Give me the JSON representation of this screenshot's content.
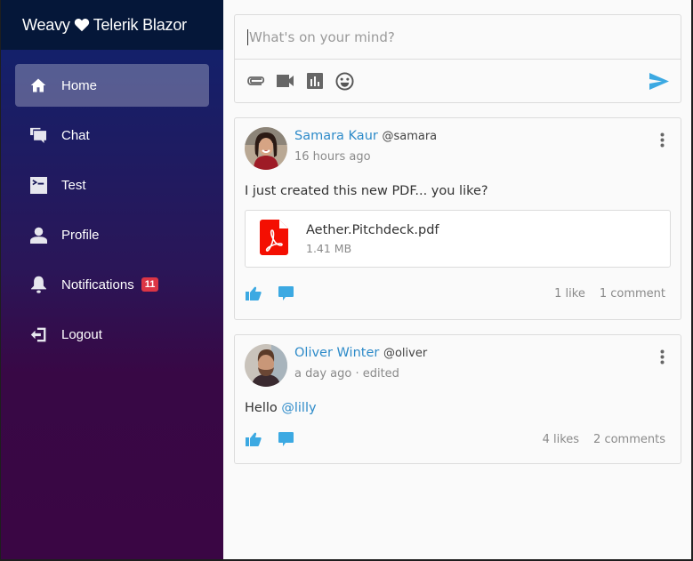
{
  "sidebar": {
    "brand": {
      "left": "Weavy",
      "icon": "heart-icon",
      "right": "Telerik Blazor"
    },
    "items": [
      {
        "label": "Home",
        "icon": "home-icon",
        "active": true
      },
      {
        "label": "Chat",
        "icon": "chat-icon",
        "active": false
      },
      {
        "label": "Test",
        "icon": "terminal-icon",
        "active": false
      },
      {
        "label": "Profile",
        "icon": "user-icon",
        "active": false
      },
      {
        "label": "Notifications",
        "icon": "bell-icon",
        "active": false,
        "badge": "11"
      },
      {
        "label": "Logout",
        "icon": "logout-icon",
        "active": false
      }
    ]
  },
  "composer": {
    "placeholder": "What's on your mind?",
    "tools": [
      "attach-icon",
      "video-icon",
      "poll-icon",
      "emoji-icon"
    ],
    "send_icon": "send-icon"
  },
  "colors": {
    "accent": "#2e8bc9",
    "send": "#3ca9e2",
    "badge": "#dc3545",
    "pdf": "#f40f02"
  },
  "posts": [
    {
      "author": "Samara Kaur",
      "handle": "@samara",
      "time": "16 hours ago",
      "text": "I just created this new PDF... you like?",
      "attachment": {
        "name": "Aether.Pitchdeck.pdf",
        "size": "1.41 MB",
        "icon": "pdf-icon"
      },
      "likes": "1 like",
      "comments": "1 comment"
    },
    {
      "author": "Oliver Winter",
      "handle": "@oliver",
      "time": "a day ago · edited",
      "text": "Hello ",
      "mention": "@lilly",
      "likes": "4 likes",
      "comments": "2 comments"
    }
  ]
}
